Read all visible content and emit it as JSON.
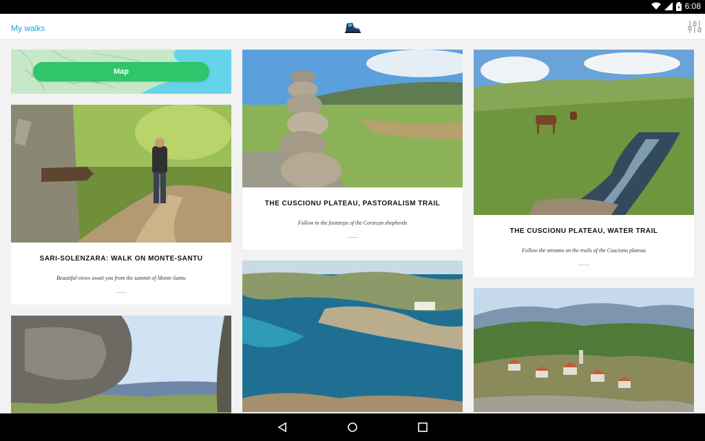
{
  "status_bar": {
    "time": "6:08"
  },
  "app_bar": {
    "title": "My walks"
  },
  "map_card": {
    "button_label": "Map"
  },
  "walks": [
    {
      "title": "SARI-SOLENZARA: WALK ON MONTE-SANTU",
      "subtitle": "Beautiful views await you from the summit of Monte-Santu"
    },
    {
      "title": "THE CUSCIONU PLATEAU, PASTORALISM TRAIL",
      "subtitle": "Follow in the footsteps of the Corsican shepherds"
    },
    {
      "title": "THE CUSCIONU PLATEAU, WATER TRAIL",
      "subtitle": "Follow the streams on the trails of the Cuscionu plateau"
    }
  ],
  "colors": {
    "accent": "#2a9fd6",
    "map_button": "#2fc56a"
  }
}
